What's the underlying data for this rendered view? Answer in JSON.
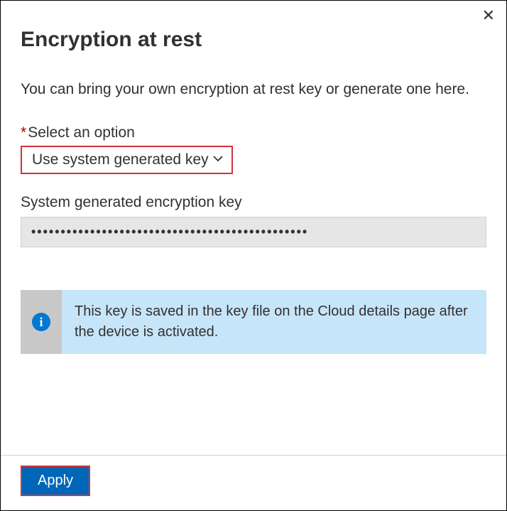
{
  "header": {
    "title": "Encryption at rest",
    "close_symbol": "✕"
  },
  "body": {
    "description": "You can bring your own encryption at rest key or generate one here.",
    "option_label": "Select an option",
    "required_marker": "*",
    "select_value": "Use system generated key",
    "key_label": "System generated encryption key",
    "key_value": "•••••••••••••••••••••••••••••••••••••••••••••••",
    "info_text": "This key is saved in the key file on the Cloud details page after the device is activated."
  },
  "footer": {
    "apply_label": "Apply"
  }
}
